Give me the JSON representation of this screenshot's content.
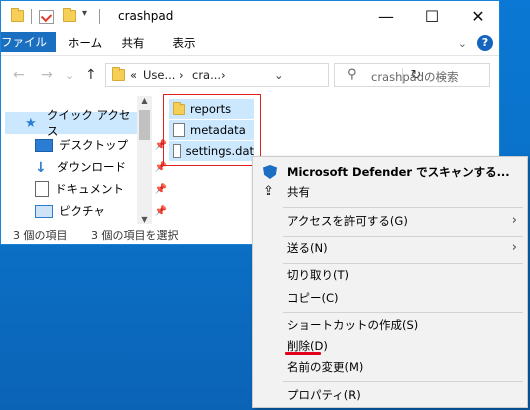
{
  "window": {
    "title": "crashpad",
    "controls": [
      "—",
      "☐",
      "✕"
    ]
  },
  "ribbon": {
    "tabs": [
      "ファイル",
      "ホーム",
      "共有",
      "表示"
    ],
    "collapse_glyph": "⌄",
    "help_glyph": "?"
  },
  "navbar": {
    "back": "←",
    "forward": "→",
    "recent": "⌄",
    "up": "↑",
    "address_segments": [
      "«",
      "Use...",
      "›",
      "cra...",
      "›"
    ],
    "address_dropdown": "⌄",
    "refresh": "↻",
    "search_placeholder": "crashpadの検索"
  },
  "sidebar": {
    "items": [
      {
        "label": "クイック アクセス",
        "icon": "star-icon"
      },
      {
        "label": "デスクトップ",
        "icon": "desktop-icon"
      },
      {
        "label": "ダウンロード",
        "icon": "download-icon"
      },
      {
        "label": "ドキュメント",
        "icon": "documents-icon"
      },
      {
        "label": "ピクチャ",
        "icon": "pictures-icon"
      }
    ],
    "pin_glyph": "📌"
  },
  "files": [
    {
      "name": "reports",
      "icon": "folder-icon"
    },
    {
      "name": "metadata",
      "icon": "file-icon"
    },
    {
      "name": "settings.dat",
      "icon": "file-icon"
    }
  ],
  "status": {
    "count": "3 個の項目",
    "selected": "3 個の項目を選択"
  },
  "context_menu": {
    "items": [
      {
        "label": "Microsoft Defender でスキャンする...",
        "icon": "defender-shield-icon"
      },
      {
        "label": "共有",
        "icon": "share-icon"
      },
      {
        "label": "アクセスを許可する(G)",
        "submenu": true
      },
      {
        "label": "送る(N)",
        "submenu": true
      },
      {
        "label": "切り取り(T)"
      },
      {
        "label": "コピー(C)"
      },
      {
        "label": "ショートカットの作成(S)"
      },
      {
        "label": "削除(D)"
      },
      {
        "label": "名前の変更(M)"
      },
      {
        "label": "プロパティ(R)"
      }
    ],
    "submenu_glyph": "›",
    "highlight_color": "#e3001b"
  },
  "colors": {
    "accent": "#1a6fc0",
    "selection": "#cce8ff",
    "desktop": "#0a78d4"
  }
}
